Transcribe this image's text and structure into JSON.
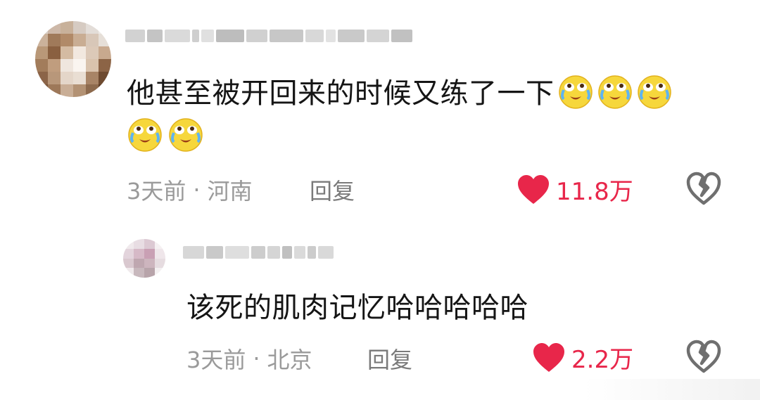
{
  "comment": {
    "text": "他甚至被开回来的时候又练了一下",
    "time": "3天前",
    "location": "河南",
    "reply_label": "回复",
    "likes": "11.8万",
    "emoji": "cry-laugh-emoji"
  },
  "reply": {
    "text": "该死的肌肉记忆哈哈哈哈哈",
    "time": "3天前",
    "location": "北京",
    "reply_label": "回复",
    "likes": "2.2万"
  },
  "separator": "·",
  "colors": {
    "like": "#e8264a",
    "meta": "#9a9a9a",
    "text": "#151515"
  }
}
